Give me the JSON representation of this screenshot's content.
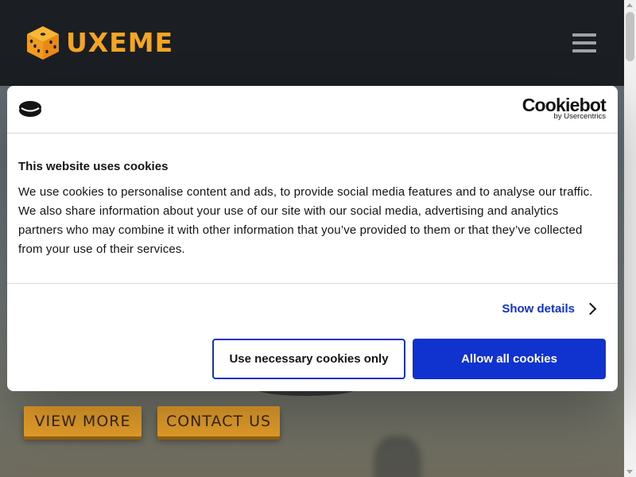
{
  "header": {
    "logo_text": "UXEME",
    "brand_color": "#f5a524"
  },
  "hero": {
    "buttons": [
      {
        "label": "VIEW MORE"
      },
      {
        "label": "CONTACT US"
      }
    ],
    "button_color": "#e9a12b"
  },
  "cookie": {
    "brand_name": "Cookiebot",
    "brand_sub": "by Usercentrics",
    "title": "This website uses cookies",
    "body": "We use cookies to personalise content and ads, to provide social media features and to analyse our traffic. We also share information about your use of our site with our social media, advertising and analytics partners who may combine it with other information that you’ve provided to them or that they’ve collected from your use of their services.",
    "show_details": "Show details",
    "necessary_label": "Use necessary cookies only",
    "allow_label": "Allow all cookies",
    "accent_color": "#1032cf"
  },
  "icons": {
    "logo": "dice-icon",
    "menu": "hamburger-menu-icon",
    "cookie": "cookie-icon",
    "details": "chevron-right-icon"
  }
}
